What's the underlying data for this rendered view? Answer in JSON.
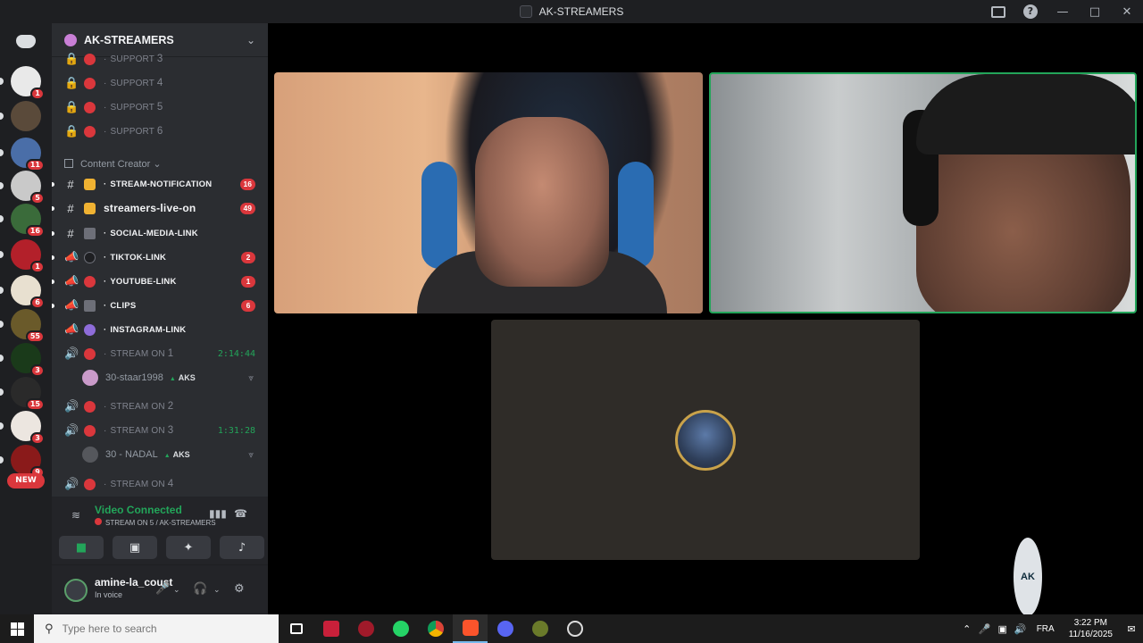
{
  "window": {
    "title": "AK-STREAMERS"
  },
  "rail": {
    "servers": [
      {
        "badge": "1",
        "color": "#e9e9e9"
      },
      {
        "badge": "",
        "color": "#5a4a3a"
      },
      {
        "badge": "11",
        "color": "#4a6ea8"
      },
      {
        "badge": "5",
        "color": "#c9c9c9"
      },
      {
        "badge": "16",
        "color": "#3a6b3a"
      },
      {
        "badge": "1",
        "color": "#b3202a"
      },
      {
        "badge": "6",
        "color": "#e8e0d0"
      },
      {
        "badge": "55",
        "color": "#6a5a2a"
      },
      {
        "badge": "3",
        "color": "#1a3a1a"
      },
      {
        "badge": "15",
        "color": "#2a2a2a"
      },
      {
        "badge": "3",
        "color": "#ece6e0"
      },
      {
        "badge": "9",
        "color": "#8a1a1a"
      }
    ],
    "new_label": "NEW"
  },
  "server": {
    "name": "AK-STREAMERS"
  },
  "channels": {
    "support": [
      {
        "label": "SUPPORT",
        "num": "3"
      },
      {
        "label": "SUPPORT",
        "num": "4"
      },
      {
        "label": "SUPPORT",
        "num": "5"
      },
      {
        "label": "SUPPORT",
        "num": "6"
      }
    ],
    "category": "Content Creator",
    "text": [
      {
        "label": "STREAM-NOTIFICATION",
        "count": "16"
      },
      {
        "label": "streamers-live-on",
        "count": "49"
      },
      {
        "label": "SOCIAL-MEDIA-LINK",
        "count": ""
      },
      {
        "label": "TIKTOK-LINK",
        "count": "2"
      },
      {
        "label": "YOUTUBE-LINK",
        "count": "1"
      },
      {
        "label": "CLIPS",
        "count": "6"
      },
      {
        "label": "INSTAGRAM-LINK",
        "count": ""
      }
    ],
    "voice": [
      {
        "label": "STREAM ON",
        "num": "1",
        "time": "2:14:44"
      },
      {
        "label": "STREAM ON",
        "num": "2",
        "time": ""
      },
      {
        "label": "STREAM ON",
        "num": "3",
        "time": "1:31:28"
      },
      {
        "label": "STREAM ON",
        "num": "4",
        "time": ""
      }
    ],
    "members": [
      {
        "name": "30-staar1998",
        "tag": "AKS"
      },
      {
        "name": "30 - NADAL",
        "tag": "AKS"
      }
    ]
  },
  "voice_panel": {
    "status": "Video Connected",
    "location": "STREAM ON 5 / AK-STREAMERS"
  },
  "user": {
    "name": "amine-la_coust",
    "status": "In voice"
  },
  "stage": {
    "corner_logo": "AK"
  },
  "taskbar": {
    "search_placeholder": "Type here to search",
    "lang": "FRA",
    "time": "3:22 PM",
    "date": "11/16/2025"
  }
}
